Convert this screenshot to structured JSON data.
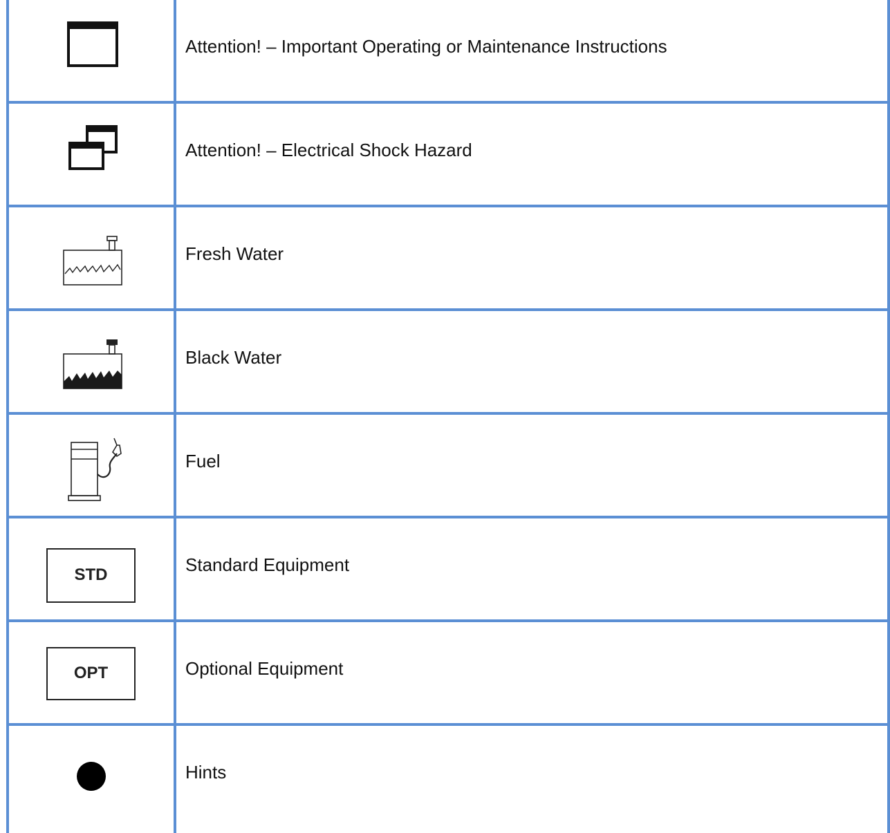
{
  "rows": [
    {
      "icon": "square-frame-icon",
      "label": "Attention! – Important Operating or Maintenance Instructions"
    },
    {
      "icon": "double-frame-icon",
      "label": "Attention! – Electrical Shock Hazard"
    },
    {
      "icon": "fresh-water-tank-icon",
      "label": "Fresh Water"
    },
    {
      "icon": "black-water-tank-icon",
      "label": "Black Water"
    },
    {
      "icon": "fuel-pump-icon",
      "label": "Fuel"
    },
    {
      "icon": "std-box-icon",
      "label": "Standard Equipment",
      "badge": "STD"
    },
    {
      "icon": "opt-box-icon",
      "label": "Optional Equipment",
      "badge": "OPT"
    },
    {
      "icon": "filled-circle-icon",
      "label": "Hints"
    }
  ],
  "colors": {
    "grid": "#5b8fd4",
    "ink": "#111111"
  }
}
